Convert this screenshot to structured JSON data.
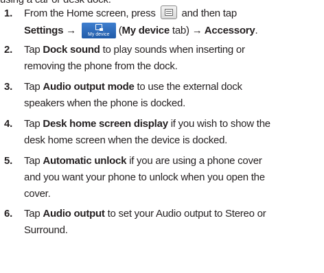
{
  "top_partial": "using a car or desk dock.",
  "icons": {
    "menu_key": "menu-key-icon",
    "my_device": "my-device-tab-icon",
    "arrow": "→"
  },
  "steps": [
    {
      "number": "1.",
      "lines": [
        {
          "a": "From the Home screen, press",
          "b": "and then tap"
        },
        {
          "s1": "Settings →",
          "s2": "My device",
          "s3": "(",
          "s4": "My device",
          "s5": "tab)",
          "s6": "→ Accessory",
          "s7": "."
        }
      ]
    },
    {
      "number": "2.",
      "lines": [
        {
          "pre": "Tap ",
          "bold": "Dock sound",
          "post": " to play sounds when inserting or"
        },
        {
          "text": "removing the phone from the dock."
        }
      ]
    },
    {
      "number": "3.",
      "lines": [
        {
          "pre": "Tap ",
          "bold": "Audio output mode",
          "post": " to use the external dock"
        },
        {
          "text": "speakers when the phone is docked."
        }
      ]
    },
    {
      "number": "4.",
      "lines": [
        {
          "pre": "Tap ",
          "bold": "Desk home screen display",
          "post": " if you wish to show the"
        },
        {
          "text": "desk home screen when the device is docked."
        }
      ]
    },
    {
      "number": "5.",
      "lines": [
        {
          "pre": "Tap ",
          "bold": "Automatic unlock",
          "post": " if you are using a phone cover"
        },
        {
          "text": "and you want your phone to unlock when you open the"
        },
        {
          "text": "cover."
        }
      ]
    },
    {
      "number": "6.",
      "lines": [
        {
          "pre": "Tap ",
          "bold": "Audio output",
          "post": " to set your Audio output to Stereo or"
        },
        {
          "text": "Surround."
        }
      ]
    }
  ]
}
